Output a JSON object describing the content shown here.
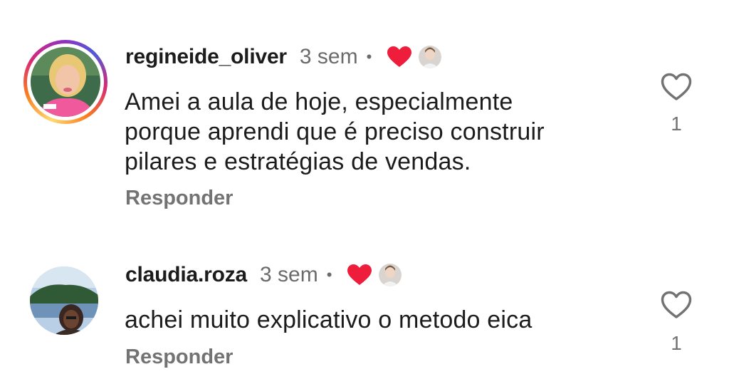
{
  "comments": [
    {
      "username": "regineide_oliver",
      "time": "3 sem",
      "separator": "•",
      "text_lines": [
        "Amei a aula de hoje, especialmente",
        "porque aprendi que é preciso construir",
        "pilares e estratégias de vendas."
      ],
      "reply_label": "Responder",
      "like_count": "1",
      "creator_liked": true,
      "avatar_has_story_ring": true
    },
    {
      "username": "claudia.roza",
      "time": "3 sem",
      "separator": "•",
      "text_lines": [
        "achei muito explicativo o metodo eica"
      ],
      "reply_label": "Responder",
      "like_count": "1",
      "creator_liked": true,
      "avatar_has_story_ring": false
    }
  ],
  "colors": {
    "heart_red": "#ee1d3c",
    "secondary_text": "#737373",
    "primary_text": "#1c1c1c"
  },
  "icons": {
    "creator_heart": "heart-filled-icon",
    "like": "heart-outline-icon"
  }
}
